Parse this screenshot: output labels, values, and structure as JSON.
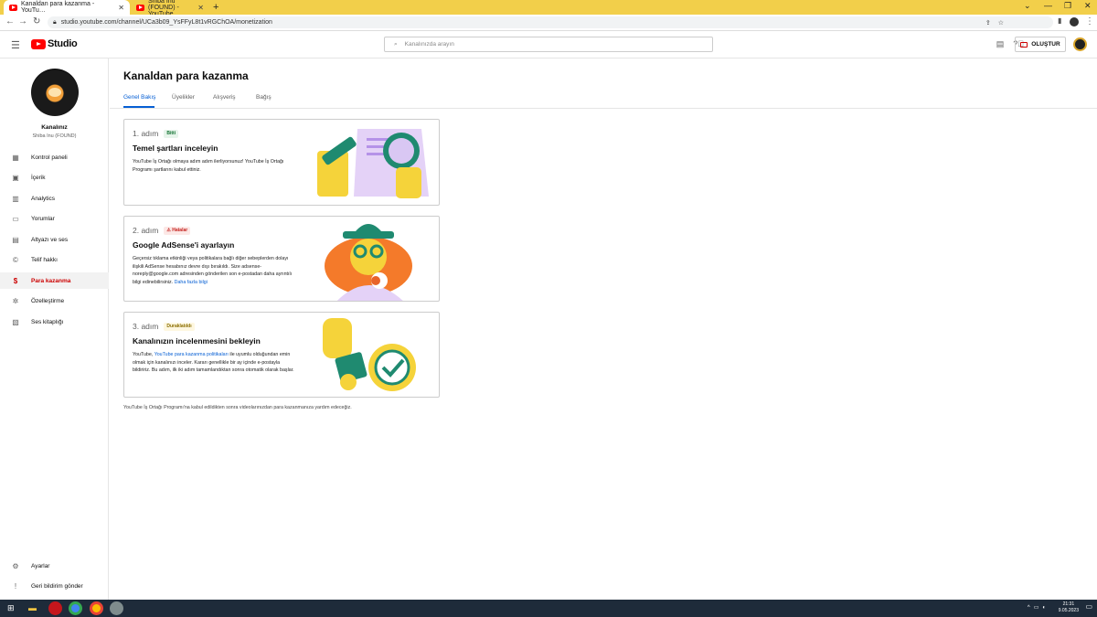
{
  "browser": {
    "tabs": [
      {
        "title": "Kanaldan para kazanma - YouTu…"
      },
      {
        "title": "Shiba Inu (FOUND) - YouTube"
      }
    ],
    "url": "studio.youtube.com/channel/UCa3b09_YsFFyL8t1vRGChOA/monetization"
  },
  "header": {
    "logo_text": "Studio",
    "search_placeholder": "Kanalınızda arayın",
    "create_label": "OLUŞTUR"
  },
  "sidebar": {
    "channel_label": "Kanalınız",
    "channel_name": "Shiba Inu (FOUND)",
    "items": [
      {
        "label": "Kontrol paneli",
        "icon": "dashboard-icon"
      },
      {
        "label": "İçerik",
        "icon": "content-icon"
      },
      {
        "label": "Analytics",
        "icon": "analytics-icon"
      },
      {
        "label": "Yorumlar",
        "icon": "comments-icon"
      },
      {
        "label": "Altyazı ve ses",
        "icon": "subtitles-icon"
      },
      {
        "label": "Telif hakkı",
        "icon": "copyright-icon"
      },
      {
        "label": "Para kazanma",
        "icon": "dollar-icon"
      },
      {
        "label": "Özelleştirme",
        "icon": "magic-wand-icon"
      },
      {
        "label": "Ses kitaplığı",
        "icon": "audio-library-icon"
      }
    ],
    "bottom": [
      {
        "label": "Ayarlar",
        "icon": "gear-icon"
      },
      {
        "label": "Geri bildirim gönder",
        "icon": "feedback-icon"
      }
    ]
  },
  "page": {
    "title": "Kanaldan para kazanma",
    "tabs": [
      "Genel Bakış",
      "Üyelikler",
      "Alışveriş",
      "Bağış"
    ]
  },
  "cards": [
    {
      "step": "1. adım",
      "badge": "Bitti",
      "title": "Temel şartları inceleyin",
      "desc": "YouTube İş Ortağı olmaya adım adım ilerliyorsunuz! YouTube İş Ortağı Programı şartlarını kabul ettiniz."
    },
    {
      "step": "2. adım",
      "badge": "Hatalar",
      "title": "Google AdSense'i ayarlayın",
      "desc": "Geçersiz tıklama etkinliği veya politikalara bağlı diğer sebeplerden dolayı ilişkili AdSense hesabınız devre dışı bırakıldı. Size adsense-noreply@google.com adresinden gönderilen son e-postadan daha ayrıntılı bilgi edinebilirsiniz.",
      "link": "Daha fazla bilgi"
    },
    {
      "step": "3. adım",
      "badge": "Duraklatıldı",
      "title": "Kanalınızın incelenmesini bekleyin",
      "desc_before": "YouTube,",
      "link": "YouTube para kazanma politikaları",
      "desc_after": "ile uyumlu olduğundan emin olmak için kanalınızı inceler. Kararı genellikle bir ay içinde e-postayla bildiririz. Bu adım, ilk iki adım tamamlandıktan sonra otomatik olarak başlar."
    }
  ],
  "footer_note": "YouTube İş Ortağı Programı'na kabul edildikten sonra videolarınızdan para kazanmanıza yardım edeceğiz.",
  "taskbar": {
    "time": "21:31",
    "date": "9.05.2023"
  },
  "colors": {
    "accent": "#065fd4",
    "active_nav": "#cc0000",
    "chrome_bar": "#f2cf4a"
  }
}
